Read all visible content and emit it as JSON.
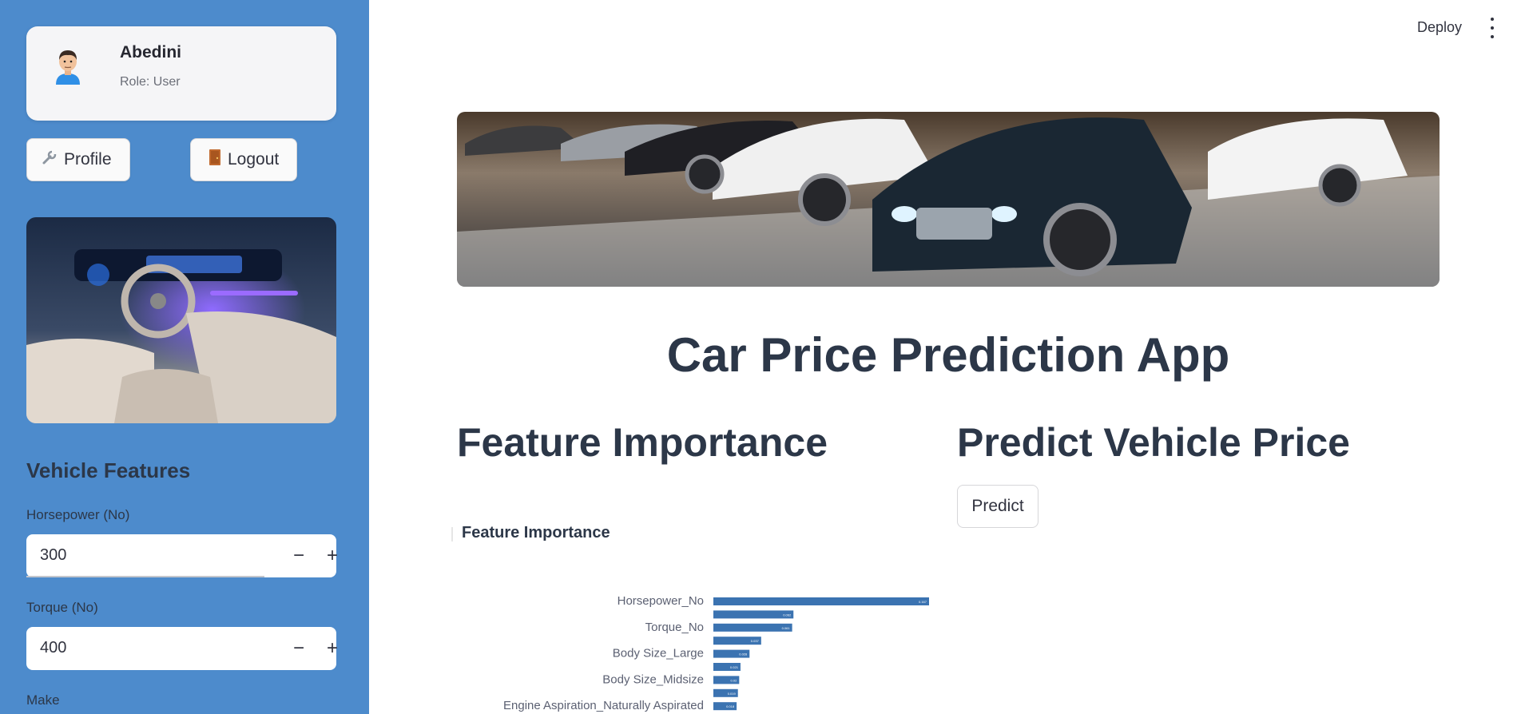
{
  "header": {
    "deploy_label": "Deploy"
  },
  "sidebar": {
    "user": {
      "name": "Abedini",
      "role": "Role: User"
    },
    "profile_label": "Profile",
    "logout_label": "Logout",
    "section_title": "Vehicle Features",
    "fields": [
      {
        "label": "Horsepower (No)",
        "value": "300"
      },
      {
        "label": "Torque (No)",
        "value": "400"
      },
      {
        "label": "Make"
      }
    ]
  },
  "main": {
    "title": "Car Price Prediction App",
    "feature_heading": "Feature Importance",
    "predict_heading": "Predict Vehicle Price",
    "predict_label": "Predict"
  },
  "chart_data": {
    "type": "bar",
    "orientation": "horizontal",
    "title": "Feature Importance",
    "color": "#3b73b1",
    "categories": [
      "Horsepower_No",
      "",
      "Torque_No",
      "",
      "Body Size_Large",
      "",
      "Body Size_Midsize",
      "",
      "Engine Aspiration_Naturally Aspirated"
    ],
    "values": [
      0.167,
      0.062,
      0.061,
      0.037,
      0.028,
      0.021,
      0.02,
      0.019,
      0.018
    ]
  }
}
